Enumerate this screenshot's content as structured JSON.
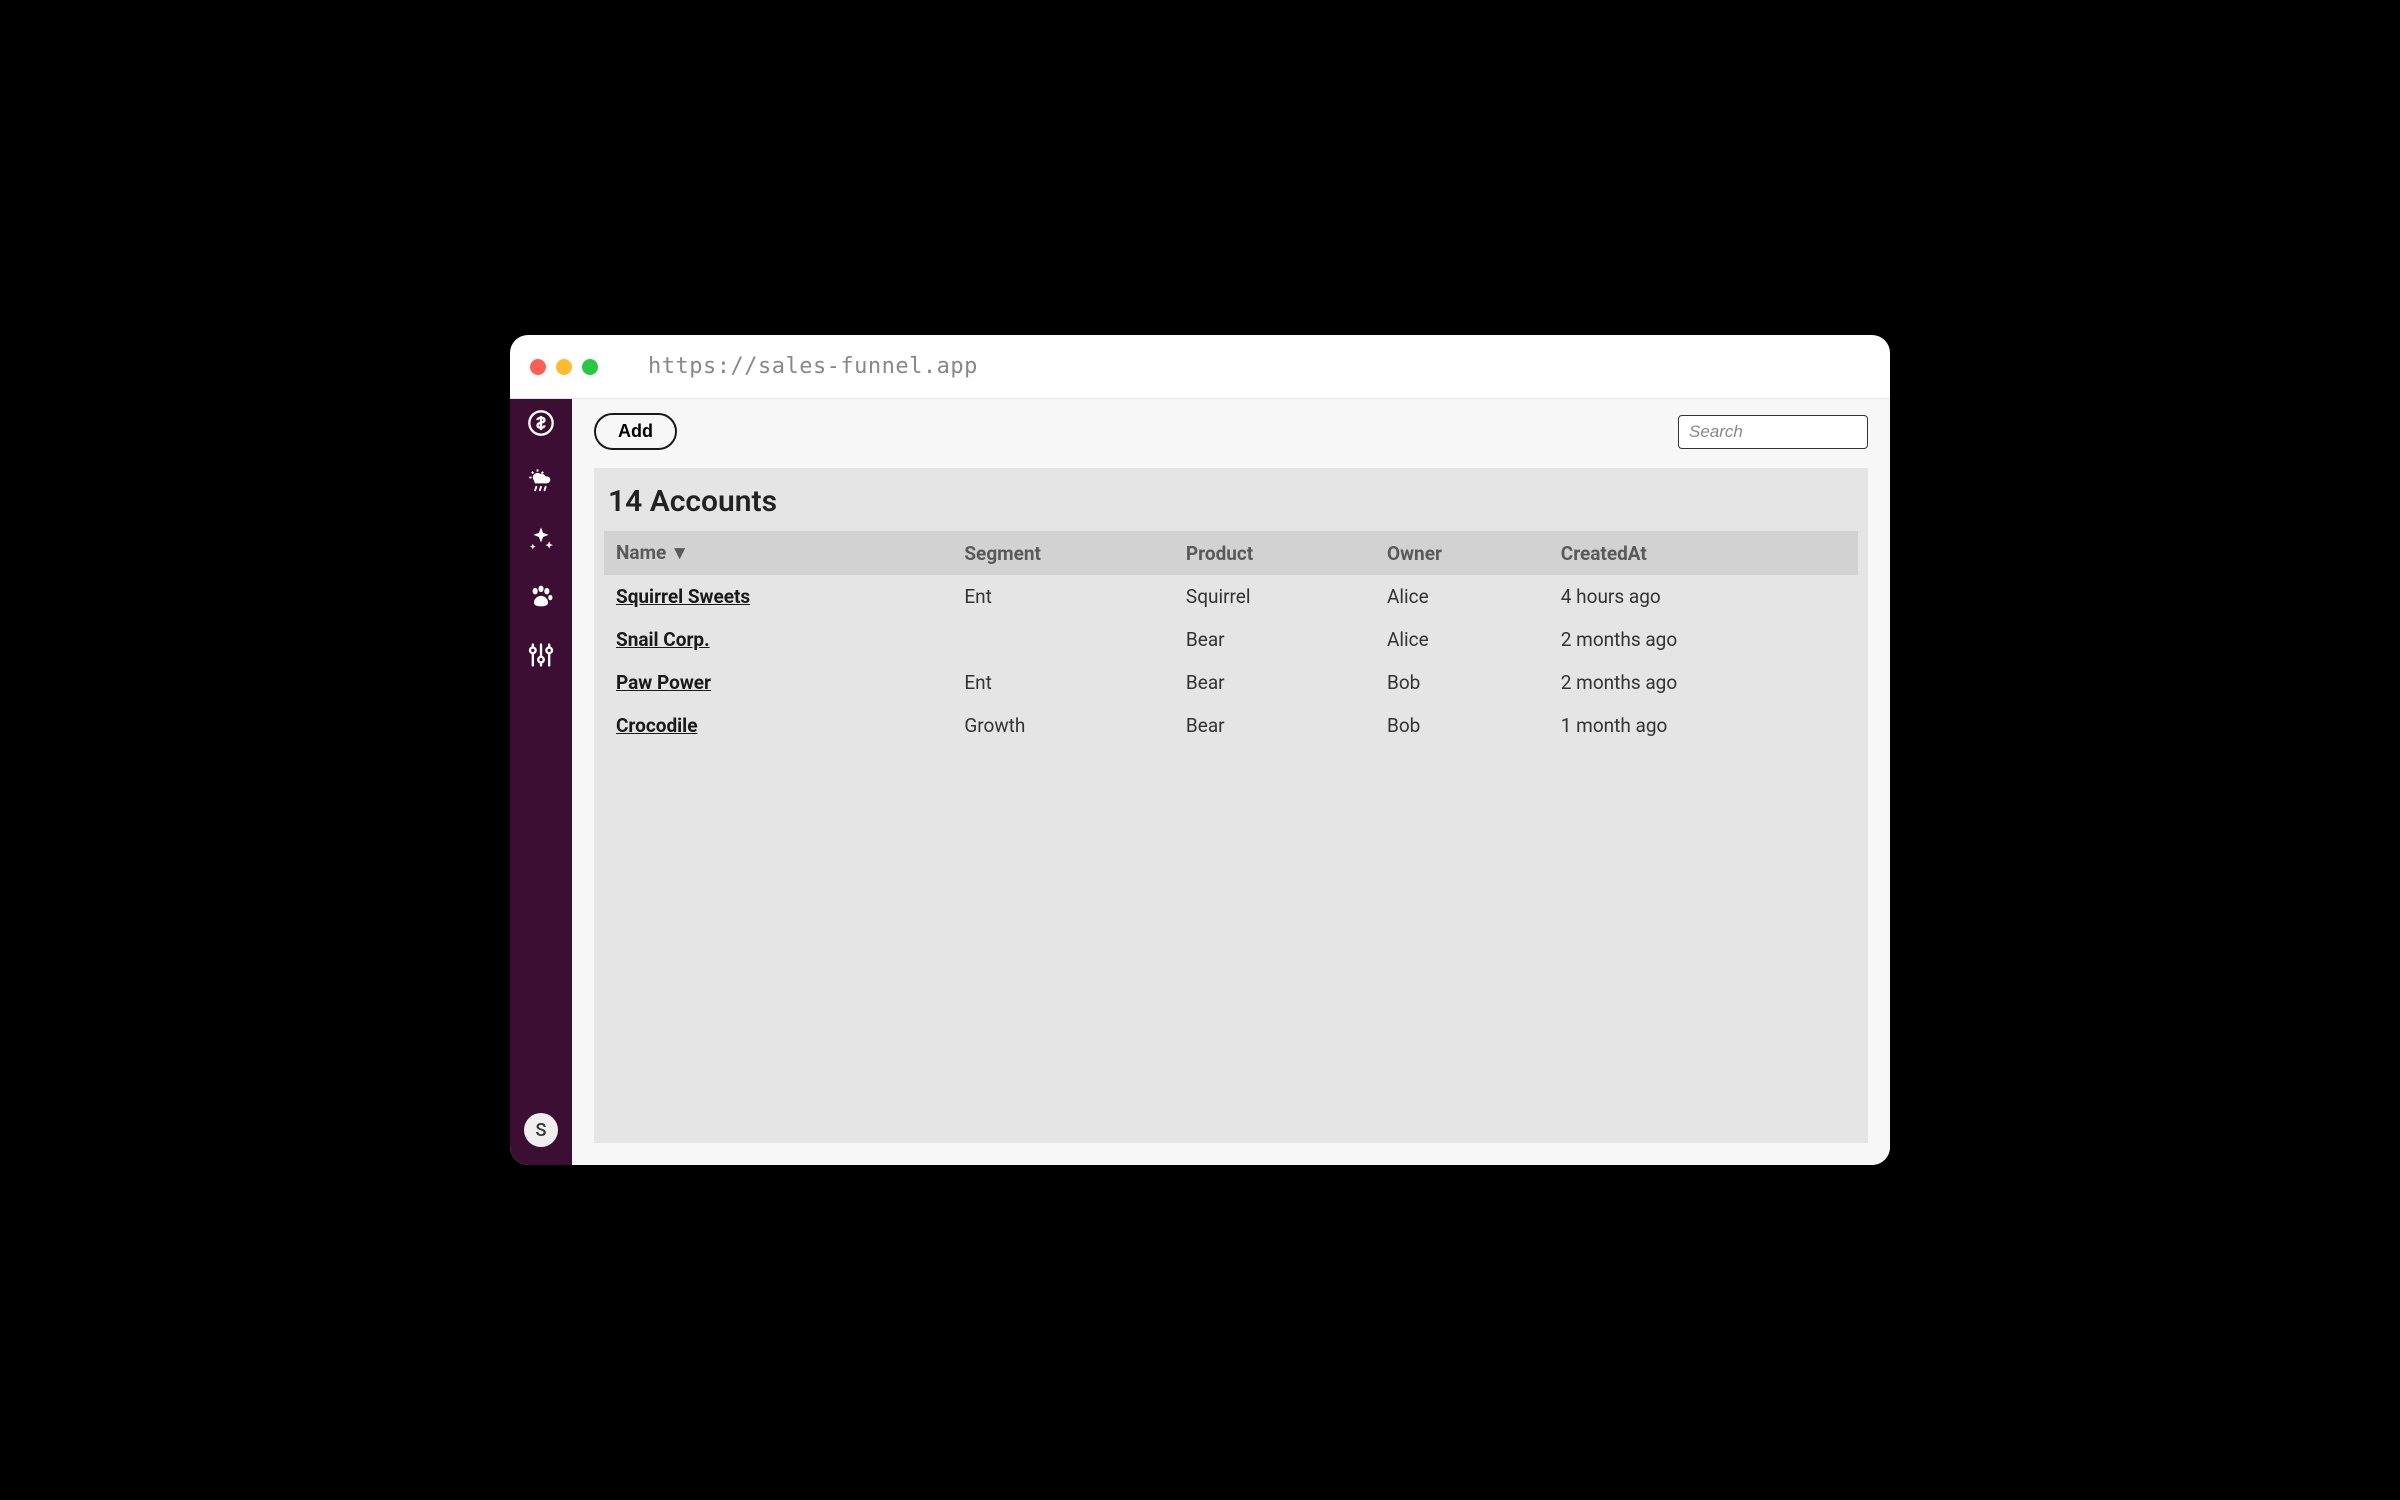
{
  "browser": {
    "url": "https://sales-funnel.app"
  },
  "sidebar": {
    "icons": [
      "dollar",
      "weather",
      "sparkle",
      "paw",
      "sliders"
    ],
    "avatar_initial": "S"
  },
  "toolbar": {
    "add_label": "Add",
    "search_placeholder": "Search"
  },
  "panel": {
    "title": "14 Accounts"
  },
  "table": {
    "columns": [
      {
        "key": "name",
        "label": "Name",
        "sorted": "desc"
      },
      {
        "key": "segment",
        "label": "Segment"
      },
      {
        "key": "product",
        "label": "Product"
      },
      {
        "key": "owner",
        "label": "Owner"
      },
      {
        "key": "createdAt",
        "label": "CreatedAt"
      }
    ],
    "sort_indicator": "▼",
    "rows": [
      {
        "name": "Squirrel Sweets",
        "segment": "Ent",
        "product": "Squirrel",
        "owner": "Alice",
        "createdAt": "4 hours ago"
      },
      {
        "name": "Snail Corp.",
        "segment": "",
        "product": "Bear",
        "owner": "Alice",
        "createdAt": "2 months ago"
      },
      {
        "name": "Paw Power",
        "segment": "Ent",
        "product": "Bear",
        "owner": "Bob",
        "createdAt": "2 months ago"
      },
      {
        "name": "Crocodile",
        "segment": "Growth",
        "product": "Bear",
        "owner": "Bob",
        "createdAt": "1 month ago"
      }
    ]
  }
}
